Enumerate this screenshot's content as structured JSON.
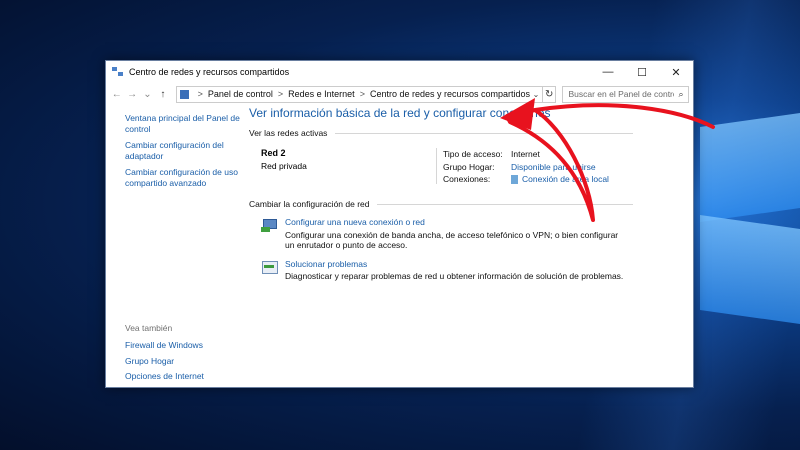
{
  "window": {
    "title": "Centro de redes y recursos compartidos",
    "controls": {
      "minimize": "—",
      "maximize": "☐",
      "close": "✕"
    }
  },
  "address": {
    "back": "←",
    "forward": "→",
    "dropdown": "⌄",
    "up": "↑",
    "crumbs": [
      "Panel de control",
      "Redes e Internet",
      "Centro de redes y recursos compartidos"
    ],
    "separator": ">",
    "refresh": "↻",
    "search_placeholder": "Buscar en el Panel de control"
  },
  "sidebar": {
    "items": [
      "Ventana principal del Panel de control",
      "Cambiar configuración del adaptador",
      "Cambiar configuración de uso compartido avanzado"
    ],
    "see_also_heading": "Vea también",
    "see_also": [
      "Firewall de Windows",
      "Grupo Hogar",
      "Opciones de Internet"
    ]
  },
  "main": {
    "heading": "Ver información básica de la red y configurar conexiones",
    "active_networks_label": "Ver las redes activas",
    "network": {
      "name": "Red 2",
      "type": "Red privada",
      "access_type_label": "Tipo de acceso:",
      "access_type_value": "Internet",
      "homegroup_label": "Grupo Hogar:",
      "homegroup_value": "Disponible para unirse",
      "connections_label": "Conexiones:",
      "connections_value": "Conexión de área local"
    },
    "change_settings_label": "Cambiar la configuración de red",
    "tasks": [
      {
        "link": "Configurar una nueva conexión o red",
        "desc": "Configurar una conexión de banda ancha, de acceso telefónico o VPN; o bien configurar un enrutador o punto de acceso.",
        "icon": "network-setup-icon"
      },
      {
        "link": "Solucionar problemas",
        "desc": "Diagnosticar y reparar problemas de red u obtener información de solución de problemas.",
        "icon": "troubleshoot-icon"
      }
    ]
  },
  "annotation": {
    "arrow_color": "#e8121e"
  }
}
